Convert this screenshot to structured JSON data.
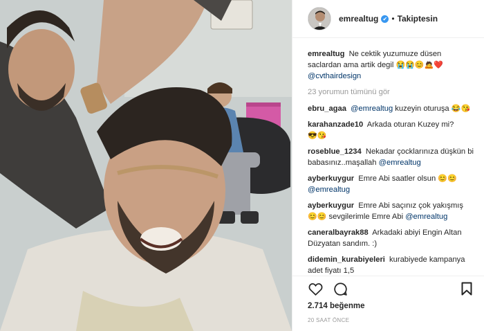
{
  "post": {
    "username": "emrealtug",
    "follow_label": "Takiptesin",
    "dot": "•",
    "verified_glyph": "✔"
  },
  "caption": {
    "user": "emrealtug",
    "text": "Ne cektik yuzumuze düsen saclardan ama artik degil",
    "emoji": "😭😭😊🙇❤️",
    "mention": "@cvthairdesign"
  },
  "view_all": "23 yorumun tümünü gör",
  "comments": [
    {
      "user": "ebru_agaa",
      "mention": "@emrealtug",
      "text": "kuzeyin oturuşa",
      "emoji": "😂😘"
    },
    {
      "user": "karahanzade10",
      "mention": "",
      "text": "Arkada oturan Kuzey mi?",
      "emoji": "😎😘"
    },
    {
      "user": "roseblue_1234",
      "mention": "@emrealtug",
      "text": "Nekadar çocklarınıza düşkün bi babasınız..maşallah",
      "emoji": ""
    },
    {
      "user": "ayberkuygur",
      "mention": "@emrealtug",
      "text": "Emre Abi saatler olsun",
      "emoji": "😊😊"
    },
    {
      "user": "ayberkuygur",
      "mention": "@emrealtug",
      "text": "Emre Abi saçınız çok yakışmış",
      "emoji": "😊😊",
      "after": "sevgilerimle Emre Abi"
    },
    {
      "user": "caneralbayrak88",
      "mention": "",
      "text": "Arkadaki abiyi Engin Altan Düzyatan sandım. :)",
      "emoji": ""
    },
    {
      "user": "didemin_kurabiyeleri",
      "mention": "",
      "text": "kurabiyede kampanya adet fiyatı 1,5",
      "emoji": ""
    }
  ],
  "likes": "2.714 beğenme",
  "time": "20 SAAT ÖNCE",
  "icons": {
    "like": "heart-outline-icon",
    "comment": "speech-bubble-icon",
    "save": "bookmark-icon",
    "verified": "verified-badge-icon"
  },
  "colors": {
    "verified_blue": "#3897f0",
    "mention_blue": "#003569",
    "muted_gray": "#999999"
  }
}
